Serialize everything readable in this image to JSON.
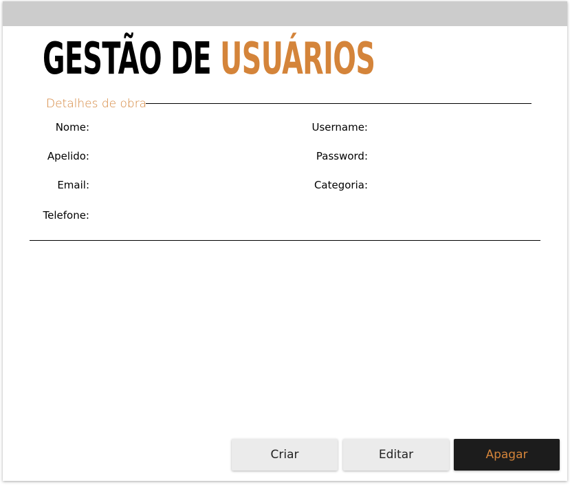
{
  "header": {
    "title_part1": "GESTÃO DE",
    "title_part2": "USUÁRIOS"
  },
  "section": {
    "label": "Detalhes de obra"
  },
  "fields": {
    "left": [
      "Nome:",
      "Apelido:",
      "Email:",
      "Telefone:"
    ],
    "right": [
      "Username:",
      "Password:",
      "Categoria:"
    ]
  },
  "buttons": {
    "create": "Criar",
    "edit": "Editar",
    "delete": "Apagar"
  },
  "colors": {
    "accent": "#d4843a",
    "titlebar": "#cccccc",
    "button_light": "#ebebeb",
    "button_dark": "#1c1c1c"
  }
}
